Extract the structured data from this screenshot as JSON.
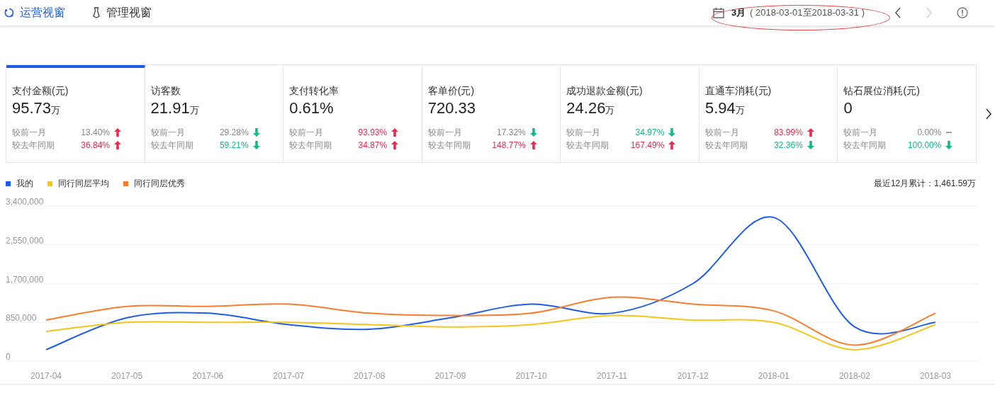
{
  "nav_tabs": [
    {
      "label": "运营视窗",
      "selected": true
    },
    {
      "label": "管理视窗",
      "selected": false
    }
  ],
  "date_range": {
    "period": "3月",
    "range": "( 2018-03-01至2018-03-31 )"
  },
  "metrics": [
    {
      "title": "支付金额(元)",
      "value": "95.73",
      "unit": "万",
      "selected": true,
      "comparisons": [
        {
          "label": "较前一月",
          "value": "13.40%",
          "kind": "up",
          "highlighted": false
        },
        {
          "label": "较去年同期",
          "value": "36.84%",
          "kind": "up",
          "highlighted": true
        }
      ]
    },
    {
      "title": "访客数",
      "value": "21.91",
      "unit": "万",
      "selected": false,
      "comparisons": [
        {
          "label": "较前一月",
          "value": "29.28%",
          "kind": "down",
          "highlighted": false
        },
        {
          "label": "较去年同期",
          "value": "59.21%",
          "kind": "down",
          "highlighted": true
        }
      ]
    },
    {
      "title": "支付转化率",
      "value": "0.61%",
      "selected": false,
      "comparisons": [
        {
          "label": "较前一月",
          "value": "93.93%",
          "kind": "up",
          "highlighted": true
        },
        {
          "label": "较去年同期",
          "value": "34.87%",
          "kind": "up",
          "highlighted": true
        }
      ]
    },
    {
      "title": "客单价(元)",
      "value": "720.33",
      "selected": false,
      "comparisons": [
        {
          "label": "较前一月",
          "value": "17.32%",
          "kind": "down",
          "highlighted": false
        },
        {
          "label": "较去年同期",
          "value": "148.77%",
          "kind": "up",
          "highlighted": true
        }
      ]
    },
    {
      "title": "成功退款金额(元)",
      "value": "24.26",
      "unit": "万",
      "selected": false,
      "comparisons": [
        {
          "label": "较前一月",
          "value": "34.97%",
          "kind": "down",
          "highlighted": true
        },
        {
          "label": "较去年同期",
          "value": "167.49%",
          "kind": "up",
          "highlighted": true
        }
      ]
    },
    {
      "title": "直通车消耗(元)",
      "value": "5.94",
      "unit": "万",
      "selected": false,
      "comparisons": [
        {
          "label": "较前一月",
          "value": "83.99%",
          "kind": "up",
          "highlighted": true
        },
        {
          "label": "较去年同期",
          "value": "32.36%",
          "kind": "down",
          "highlighted": true
        }
      ]
    },
    {
      "title": "钻石展位消耗(元)",
      "value": "0",
      "selected": false,
      "comparisons": [
        {
          "label": "较前一月",
          "value": "0.00%",
          "kind": "flat",
          "highlighted": false
        },
        {
          "label": "较去年同期",
          "value": "100.00%",
          "kind": "down",
          "highlighted": true
        }
      ]
    }
  ],
  "total": "最近12月累计：1,461.59万",
  "chart_data": {
    "type": "line",
    "categories": [
      "2017-04",
      "2017-05",
      "2017-06",
      "2017-07",
      "2017-08",
      "2017-09",
      "2017-10",
      "2017-11",
      "2017-12",
      "2018-01",
      "2018-02",
      "2018-03"
    ],
    "ylim": [
      0,
      3400000
    ],
    "grid": true,
    "yticks": [
      {
        "value": 0,
        "label": "0"
      },
      {
        "value": 850000,
        "label": "850,000"
      },
      {
        "value": 1700000,
        "label": "1,700,000"
      },
      {
        "value": 2550000,
        "label": "2,550,000"
      },
      {
        "value": 3400000,
        "label": "3,400,000"
      }
    ],
    "series": [
      {
        "name": "我的",
        "color": "#1f5de8",
        "values": [
          250000,
          950000,
          1050000,
          800000,
          700000,
          950000,
          1250000,
          1050000,
          1700000,
          3150000,
          750000,
          850000
        ]
      },
      {
        "name": "同行同层平均",
        "color": "#f5c518",
        "values": [
          650000,
          850000,
          850000,
          850000,
          800000,
          750000,
          800000,
          1000000,
          900000,
          850000,
          250000,
          800000
        ]
      },
      {
        "name": "同行同层优秀",
        "color": "#fa7d2e",
        "values": [
          900000,
          1200000,
          1200000,
          1250000,
          1050000,
          1000000,
          1050000,
          1400000,
          1250000,
          1100000,
          350000,
          1050000
        ]
      }
    ]
  }
}
